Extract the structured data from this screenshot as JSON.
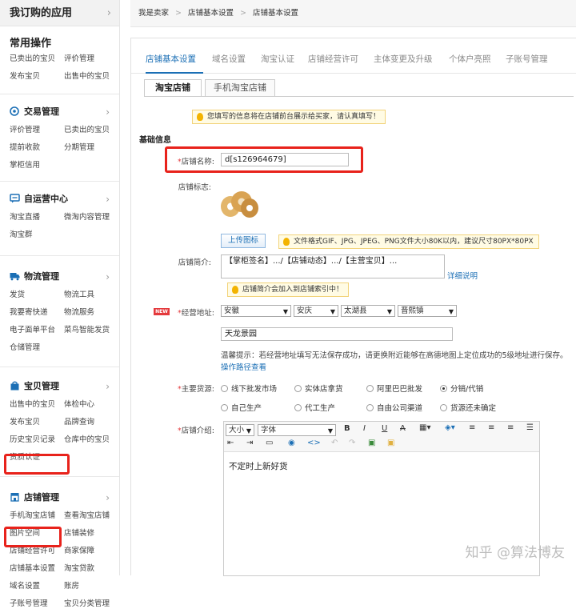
{
  "sidebar": {
    "title": "我订购的应用",
    "chevron": "›",
    "common": {
      "title": "常用操作",
      "links": [
        "已卖出的宝贝",
        "评价管理",
        "发布宝贝",
        "出售中的宝贝"
      ]
    },
    "sections": [
      {
        "title": "交易管理",
        "icon": "trade-icon",
        "links": [
          "评价管理",
          "已卖出的宝贝",
          "提前收款",
          "分期管理",
          "掌柜信用"
        ]
      },
      {
        "title": "自运营中心",
        "icon": "chat-icon",
        "links": [
          "淘宝直播",
          "微淘内容管理",
          "淘宝群"
        ]
      },
      {
        "title": "物流管理",
        "icon": "truck-icon",
        "links": [
          "发货",
          "物流工具",
          "我要寄快递",
          "物流服务",
          "电子面单平台",
          "菜鸟智能发货",
          "仓储管理"
        ]
      },
      {
        "title": "宝贝管理",
        "icon": "bag-icon",
        "links": [
          "出售中的宝贝",
          "体检中心",
          "发布宝贝",
          "品牌查询",
          "历史宝贝记录",
          "仓库中的宝贝",
          "资质认证"
        ]
      },
      {
        "title": "店铺管理",
        "icon": "store-icon",
        "links": [
          "手机淘宝店铺",
          "查看淘宝店铺",
          "图片空间",
          "店铺装修",
          "店铺经营许可",
          "商家保障",
          "店铺基本设置",
          "淘宝贷款",
          "域名设置",
          "账房",
          "子账号管理",
          "宝贝分类管理"
        ]
      }
    ]
  },
  "breadcrumb": [
    "我是卖家",
    "店铺基本设置",
    "店铺基本设置"
  ],
  "breadcrumb_sep": ">",
  "top_tabs": [
    "店铺基本设置",
    "域名设置",
    "淘宝认证",
    "店铺经营许可",
    "主体变更及升级",
    "个体户亮照",
    "子账号管理"
  ],
  "sub_tabs": [
    "淘宝店铺",
    "手机淘宝店铺"
  ],
  "notice": "您填写的信息将在店铺前台展示给买家，请认真填写！",
  "basic_info_title": "基础信息",
  "form": {
    "shop_name_label": "店铺名称:",
    "shop_name_value": "d[s126964679]",
    "logo_label": "店铺标志:",
    "upload_button": "上传图标",
    "upload_tip": "文件格式GIF、JPG、JPEG、PNG文件大小80K以内，建议尺寸80PX*80PX",
    "intro_label": "店铺简介:",
    "intro_value": "【掌柜签名】.../【店铺动态】.../【主营宝贝】...",
    "intro_detail_link": "详细说明",
    "intro_tip": "店铺简介会加入到店铺索引中！",
    "new_badge": "NEW",
    "address_label": "经营地址:",
    "address_selects": [
      "安徽",
      "安庆",
      "太湖县",
      "晋熙镇"
    ],
    "address_detail": "天龙景园",
    "address_hint": "温馨提示：若经营地址填写无法保存成功，请更换附近能够在高德地图上定位成功的5级地址进行保存。",
    "address_hint_link": "操作路径查看",
    "source_label": "主要货源:",
    "source_options": [
      "线下批发市场",
      "实体店拿货",
      "阿里巴巴批发",
      "分销/代销",
      "自己生产",
      "代工生产",
      "自由公司渠道",
      "货源还未确定"
    ],
    "source_selected": "分销/代销",
    "desc_label": "店铺介绍:",
    "editor_size": "大小",
    "editor_font": "字体",
    "editor_content": "不定时上新好货"
  },
  "watermark": "知乎 @算法博友"
}
